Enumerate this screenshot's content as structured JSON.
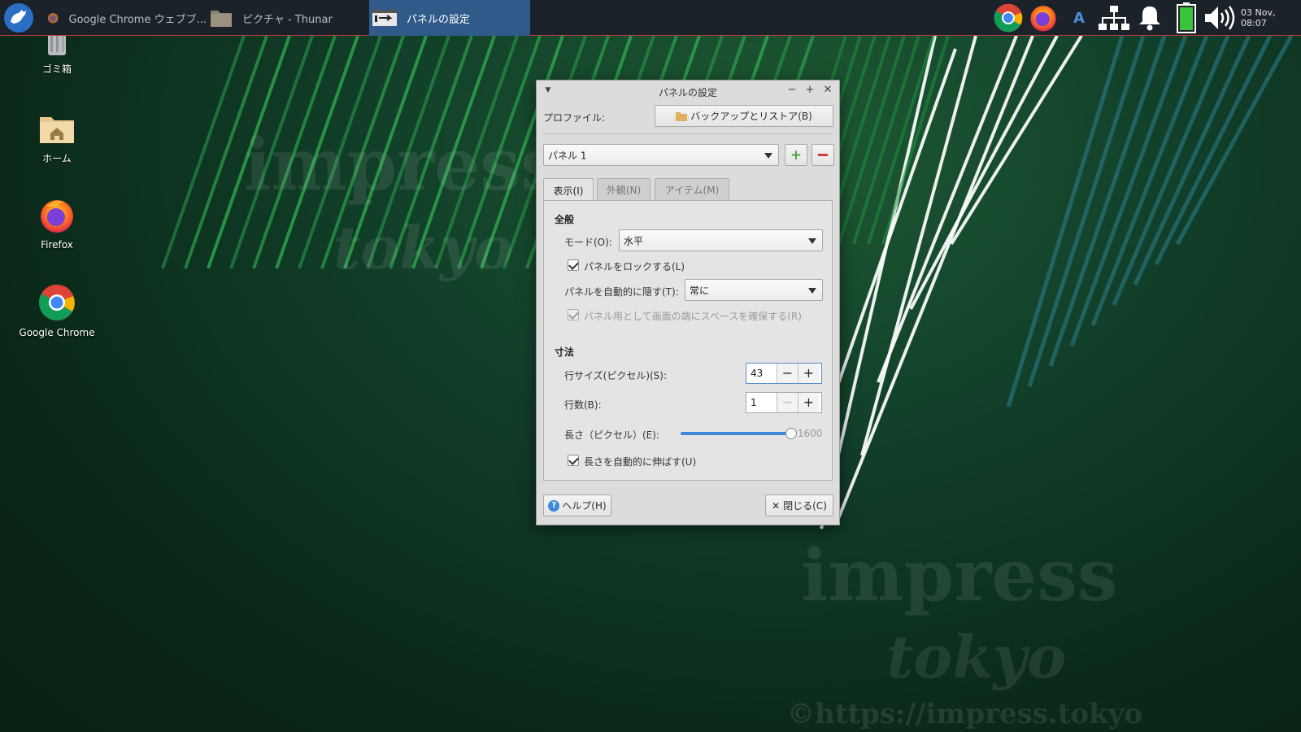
{
  "taskbar": {
    "tasks": [
      {
        "label": "Google Chrome ウェブブ...",
        "icon": "firefox-icon"
      },
      {
        "label": "ピクチャ - Thunar",
        "icon": "folder-icon"
      },
      {
        "label": "パネルの設定",
        "icon": "panel-preferences-icon"
      }
    ],
    "clock": "03 Nov, 08:07"
  },
  "desktop": {
    "icons": [
      {
        "label": "ゴミ箱",
        "icon": "trash-icon"
      },
      {
        "label": "ホーム",
        "icon": "home-folder-icon"
      },
      {
        "label": "Firefox",
        "icon": "firefox-icon"
      },
      {
        "label": "Google Chrome",
        "icon": "chrome-icon"
      }
    ]
  },
  "wallpaper": {
    "watermark_line1": "impress",
    "watermark_line2": "tokyo",
    "watermark_url": "©https://impress.tokyo"
  },
  "dialog": {
    "title": "パネルの設定",
    "profile_label": "プロファイル:",
    "backup_button": "バックアップとリストア(B)",
    "panel_select": "パネル 1",
    "tabs": [
      "表示(I)",
      "外観(N)",
      "アイテム(M)"
    ],
    "general": {
      "heading": "全般",
      "mode_label": "モード(O):",
      "mode_value": "水平",
      "lock_label": "パネルをロックする(L)",
      "lock_checked": true,
      "autohide_label": "パネルを自動的に隠す(T):",
      "autohide_value": "常に",
      "reserve_label": "パネル用として画面の端にスペースを確保する(R)",
      "reserve_checked": true
    },
    "measurements": {
      "heading": "寸法",
      "row_size_label": "行サイズ(ピクセル)(S):",
      "row_size_value": "43",
      "rows_label": "行数(B):",
      "rows_value": "1",
      "length_label": "長さ（ピクセル）(E):",
      "length_value": "1600",
      "length_fraction": 1.0,
      "autoextend_label": "長さを自動的に伸ばす(U)",
      "autoextend_checked": true
    },
    "help_button": "ヘルプ(H)",
    "close_button": "閉じる(C)"
  },
  "colors": {
    "accent": "#3f89d8",
    "taskbar_bg": "#1c2229",
    "taskbar_border": "#c13a3a",
    "active_task": "#2f5a8a"
  }
}
